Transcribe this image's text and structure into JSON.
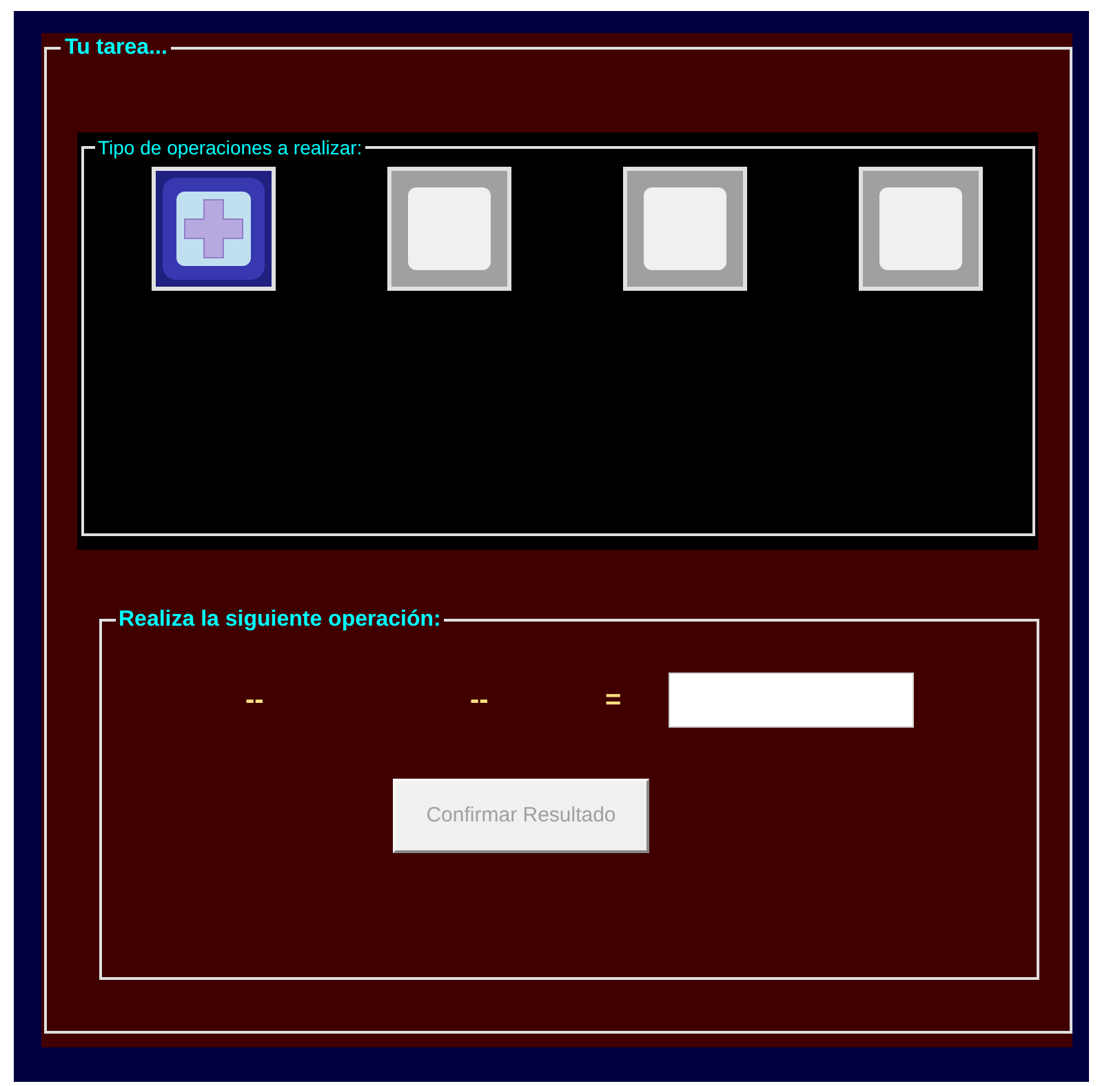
{
  "task_group": {
    "title": "Tu tarea..."
  },
  "operations_group": {
    "title": "Tipo de operaciones a realizar:",
    "operations": [
      {
        "selected": true
      },
      {
        "selected": false
      },
      {
        "selected": false
      },
      {
        "selected": false
      }
    ]
  },
  "exercise_group": {
    "title": "Realiza la siguiente operación:",
    "operand_1": "--",
    "operand_2": "--",
    "equals": "=",
    "confirm_button": {
      "label": "Confirmar Resultado",
      "disabled": true
    }
  }
}
